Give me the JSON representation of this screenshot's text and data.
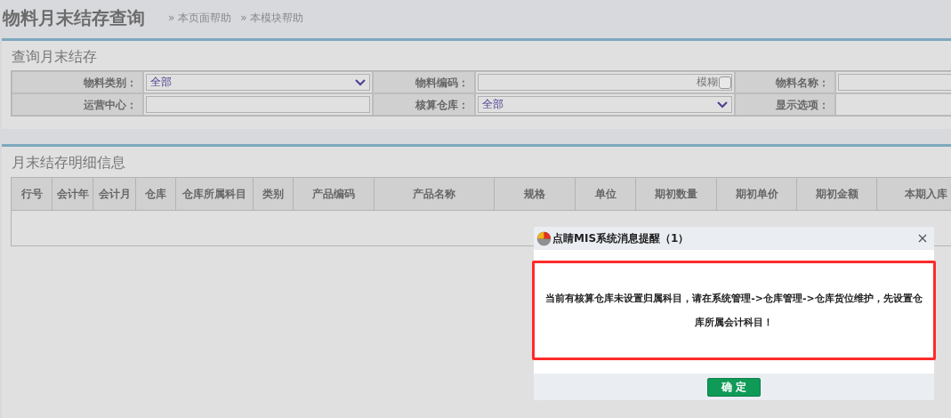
{
  "page_title": "物料月末结存查询",
  "help_links": [
    "» 本页面帮助",
    "» 本模块帮助"
  ],
  "query_panel": {
    "title": "查询月末结存",
    "fields": [
      {
        "label": "物料类别：",
        "kind": "select",
        "value": "全部"
      },
      {
        "label": "物料编码：",
        "kind": "text_fuzzy",
        "fuzzy_label": "模糊",
        "checked": false
      },
      {
        "label": "物料名称：",
        "kind": "text"
      },
      {
        "label": "运营中心：",
        "kind": "text"
      },
      {
        "label": "核算仓库：",
        "kind": "select",
        "value": "全部"
      },
      {
        "label": "显示选项：",
        "kind": "empty"
      }
    ]
  },
  "detail_panel": {
    "title": "月末结存明细信息",
    "table": {
      "columns": [
        "行号",
        "会计年",
        "会计月",
        "仓库",
        "仓库所属科目",
        "类别",
        "产品编码",
        "产品名称",
        "规格",
        "单位",
        "期初数量",
        "期初单价",
        "期初金额",
        "本期入库"
      ]
    }
  },
  "dialog": {
    "title": "点睛MIS系统消息提醒（1）",
    "message": "当前有核算仓库未设置归属科目，请在系统管理->仓库管理->仓库货位维护，先设置仓库所属会计科目！",
    "button": "确 定"
  }
}
